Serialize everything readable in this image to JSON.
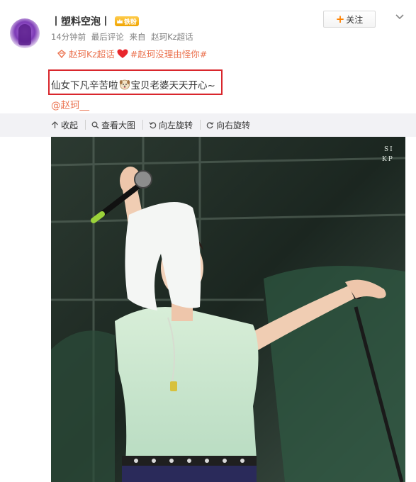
{
  "post": {
    "username": "丨塑料空泡丨",
    "vip_badge": "铁粉",
    "time": "14分钟前",
    "last_comment": "最后评论",
    "source_prefix": "来自",
    "source": "赵珂Kz超话",
    "follow_label": "关注",
    "topic_1": "赵珂Kz超话",
    "topic_2": "#赵珂没理由怪你#",
    "text_part1": "仙女下凡辛苦啦",
    "text_part2": "宝贝老婆天天开心~",
    "mention": "@赵珂__"
  },
  "media": {
    "actions": [
      "收起",
      "查看大图",
      "向左旋转",
      "向右旋转"
    ],
    "watermark_line1": "SI",
    "watermark_line2": "KP"
  },
  "colors": {
    "accent": "#eb7350",
    "highlight_box": "#d9262c",
    "follow_plus": "#ff8200"
  },
  "icons": [
    "topic-diamond-icon",
    "heart-icon",
    "dog-emoji-icon",
    "collapse-icon",
    "magnifier-icon",
    "rotate-left-icon",
    "rotate-right-icon",
    "chevron-down-icon"
  ]
}
